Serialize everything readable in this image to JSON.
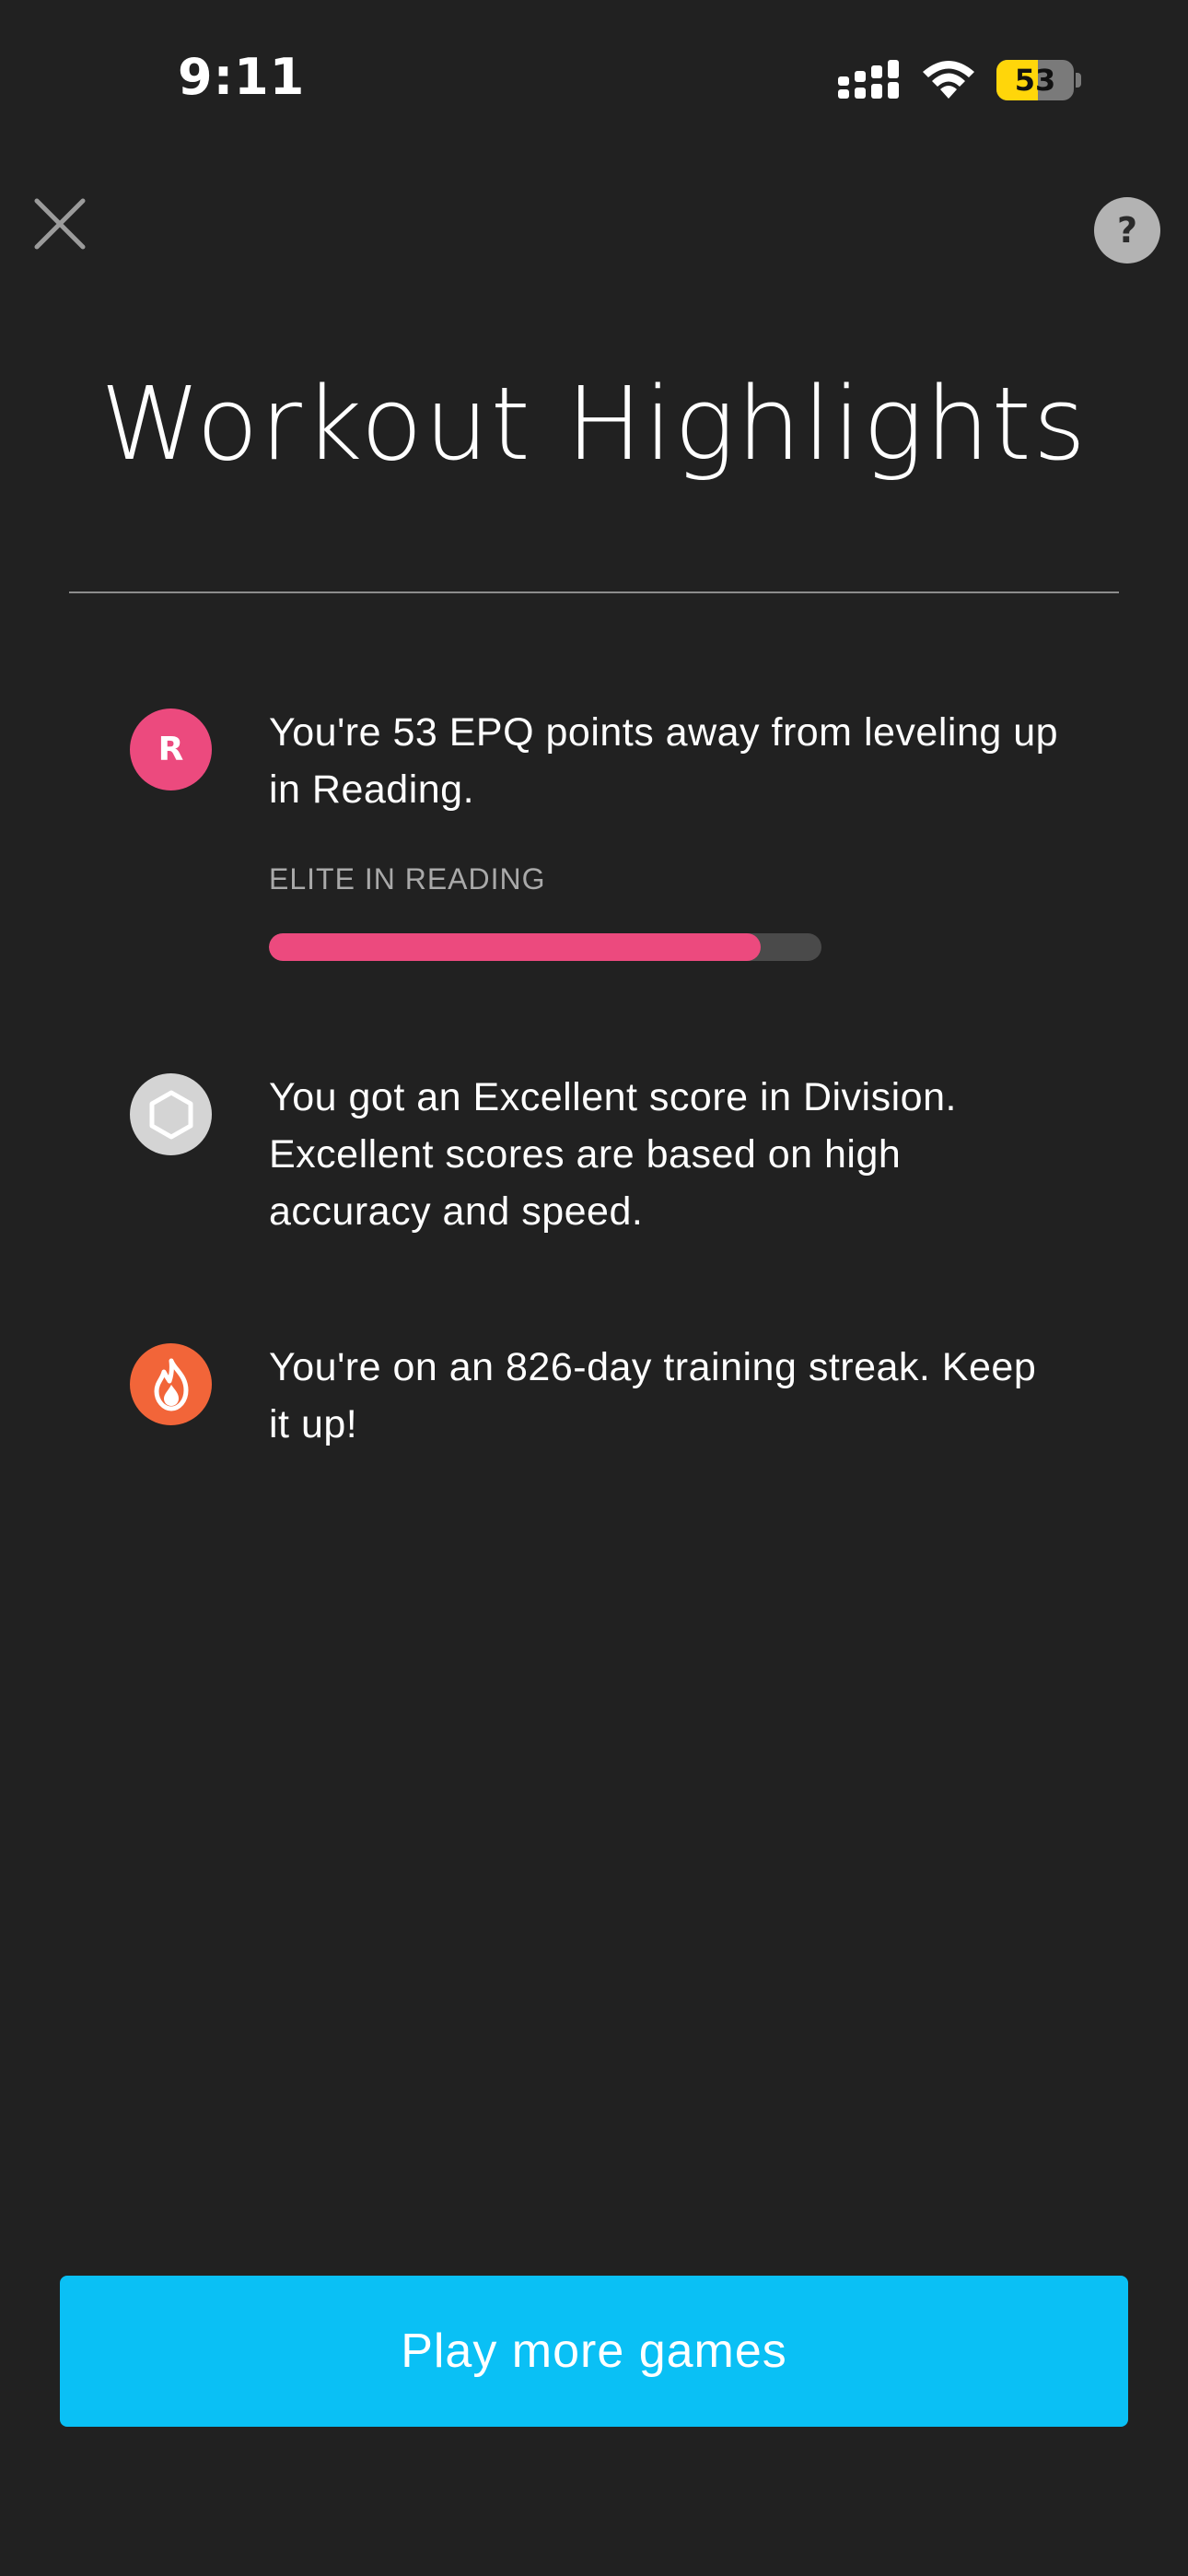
{
  "status_bar": {
    "time": "9:11",
    "battery_level": "53",
    "battery_fraction": 0.53,
    "signal_icon": "cellular-signal-icon",
    "wifi_icon": "wifi-icon"
  },
  "header": {
    "close_icon": "close-icon",
    "help_label": "?",
    "title": "Workout Highlights"
  },
  "highlights": [
    {
      "icon": "reading-badge-icon",
      "icon_letter": "R",
      "icon_color": "#ec4a7e",
      "text": "You're 53 EPQ points away from leveling up in Reading.",
      "progress_label": "ELITE IN READING",
      "progress_fraction": 0.89
    },
    {
      "icon": "hexagon-icon",
      "icon_color": "#d4d4d4",
      "text": "You got an Excellent score in Division. Excellent scores are based on high accuracy and speed."
    },
    {
      "icon": "flame-icon",
      "icon_color": "#f26539",
      "text": "You're on an 826-day training streak. Keep it up!"
    }
  ],
  "cta": {
    "label": "Play more games",
    "color": "#0ac0f5"
  }
}
